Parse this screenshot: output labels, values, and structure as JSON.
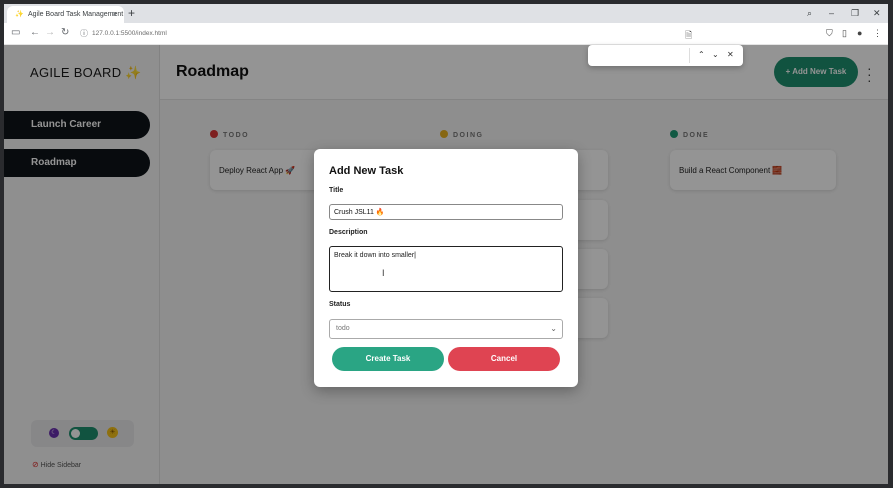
{
  "browser": {
    "tab_title": "Agile Board Task Management",
    "tab_favicon": "✨",
    "url": "127.0.0.1:5500/index.html",
    "find_bar": {
      "query": ""
    }
  },
  "sidebar": {
    "logo_text": "AGILE BOARD",
    "logo_emoji": "✨",
    "boards": [
      {
        "label": "Launch Career"
      },
      {
        "label": "Roadmap"
      }
    ],
    "theme_toggle": {
      "moon_icon": "moon-icon",
      "sun_icon": "sun-icon",
      "dark_mode": false
    },
    "hide_sidebar_label": "Hide Sidebar"
  },
  "header": {
    "title": "Roadmap",
    "add_task_label": "+ Add New Task"
  },
  "board": {
    "columns": [
      {
        "name": "TODO",
        "color": "#d93838",
        "tasks": [
          "Deploy React App 🚀"
        ]
      },
      {
        "name": "DOING",
        "color": "#e8b21f",
        "tasks": []
      },
      {
        "name": "DONE",
        "color": "#1e9a74",
        "tasks": [
          "Build a React Component 🧱"
        ]
      }
    ]
  },
  "modal": {
    "heading": "Add New Task",
    "title_label": "Title",
    "title_value": "Crush JSL11 🔥",
    "description_label": "Description",
    "description_value": "Break it down into smaller",
    "status_label": "Status",
    "status_value": "todo",
    "create_label": "Create Task",
    "cancel_label": "Cancel"
  },
  "colors": {
    "accent": "#1e8f6e",
    "create_button": "#2aa584",
    "cancel_button": "#df4452",
    "board_button": "#0f1419"
  }
}
